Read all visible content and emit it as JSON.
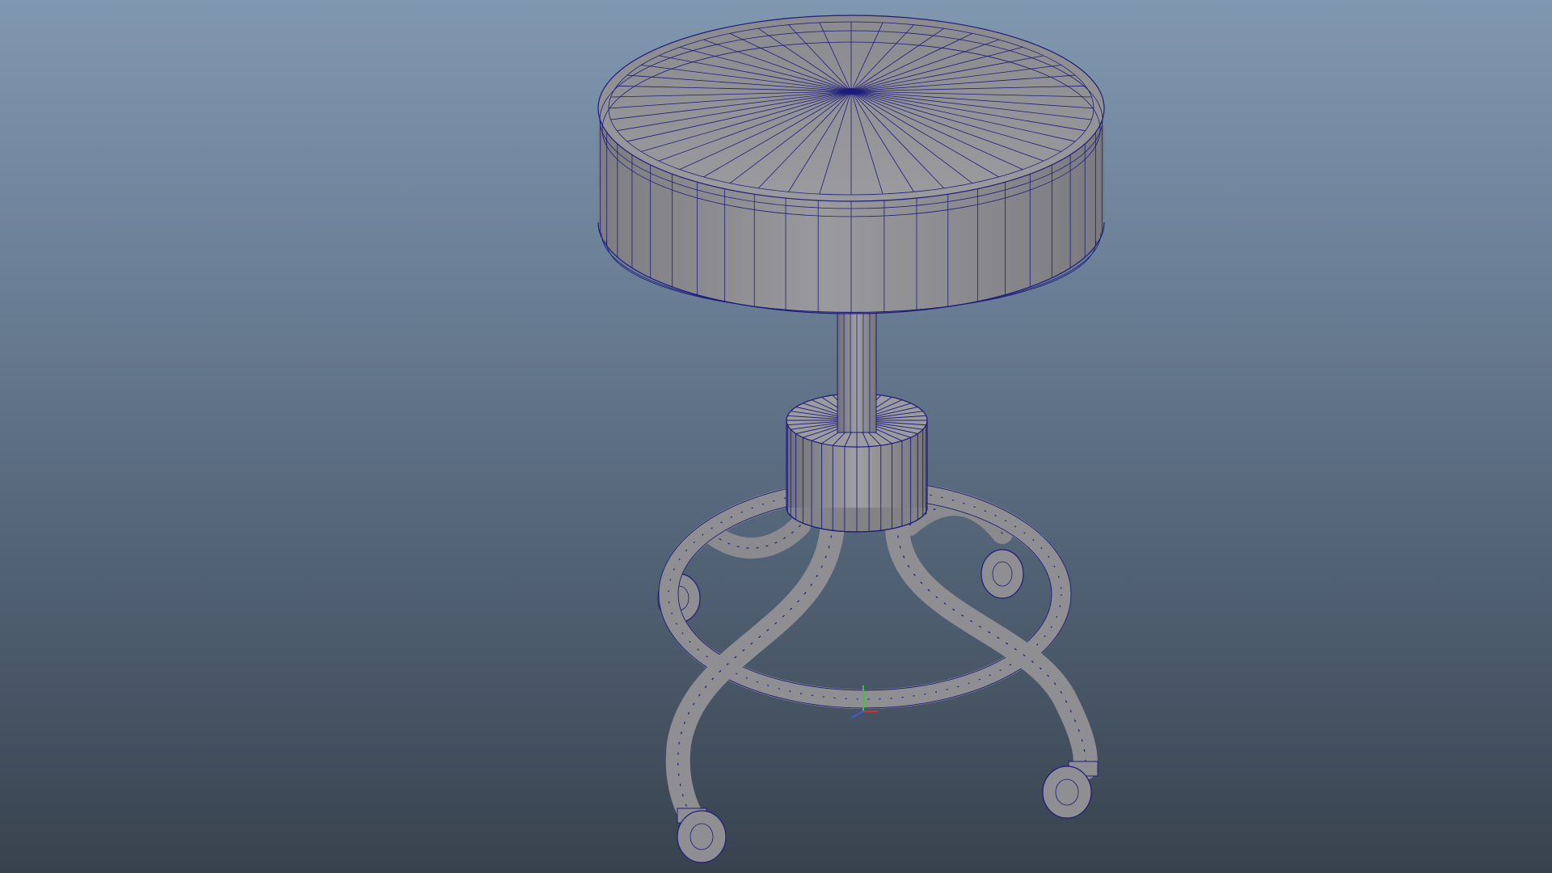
{
  "viewport": {
    "background_top": "#8097b0",
    "background_bottom": "#38424e"
  },
  "model": {
    "name": "stool",
    "shading": "wireframe-on-shaded",
    "surface_color": "#8e8e93",
    "wire_color": "#1c1c7a"
  },
  "axis_gizmo": {
    "x_color": "#d0303a",
    "y_color": "#3cc43c",
    "z_color": "#3c5cd8"
  }
}
